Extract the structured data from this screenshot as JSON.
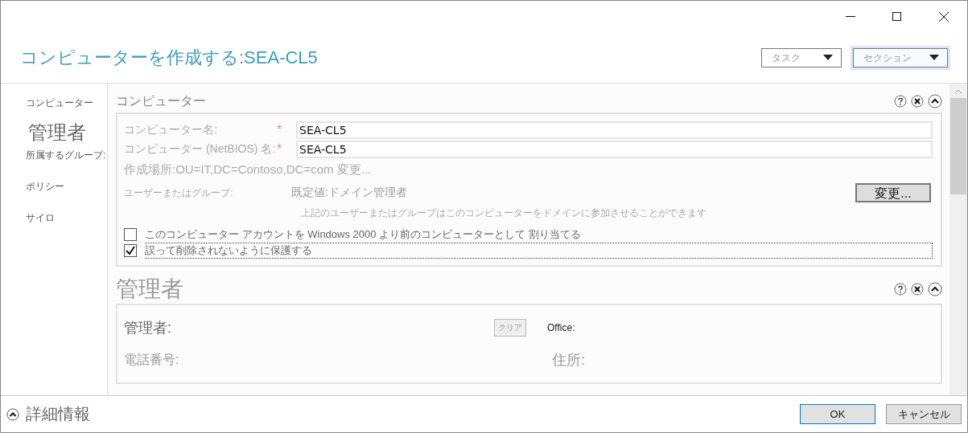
{
  "window": {
    "title": "コンピューターを作成する:SEA-CL5"
  },
  "header_dropdowns": [
    {
      "label": "タスク",
      "focused": false
    },
    {
      "label": "セクション",
      "focused": true
    }
  ],
  "sidebar": {
    "items": [
      {
        "label": "コンピューター",
        "selected": false
      },
      {
        "label": "管理者",
        "selected": true
      },
      {
        "label": "所属するグループ:",
        "selected": false
      },
      {
        "label": "ポリシー",
        "selected": false
      },
      {
        "label": "サイロ",
        "selected": false
      }
    ]
  },
  "computer_section": {
    "heading": "コンピューター",
    "fields": [
      {
        "label": "コンピューター名:",
        "required_mark": "*",
        "value": "SEA-CL5"
      },
      {
        "label": "コンピューター (NetBIOS) 名:",
        "required_mark": "*",
        "value": "SEA-CL5"
      }
    ],
    "location": "作成場所:OU=IT,DC=Contoso,DC=com",
    "location_link": "変更...",
    "user_group_label": "ユーザーまたはグループ:",
    "user_group_value": "既定値:ドメイン管理者",
    "change_button": "変更...",
    "note": "上記のユーザーまたはグループはこのコンピューターをドメインに参加させることができます",
    "checkboxes": [
      {
        "label": "このコンピューター アカウントを Windows  2000 より前のコンピューターとして 割り当てる",
        "checked": false
      },
      {
        "label": "誤って削除されないように保護する",
        "checked": true
      }
    ]
  },
  "manager_section": {
    "heading": "管理者",
    "manager_label": "管理者:",
    "clear_button": "クリア",
    "office_label": "Office:",
    "phone_label": "電話番号:",
    "address_label": "住所:"
  },
  "footer": {
    "details": "詳細情報",
    "buttons": [
      {
        "label": "OK",
        "selected": true
      },
      {
        "label": "キャンセル",
        "selected": false
      }
    ]
  }
}
